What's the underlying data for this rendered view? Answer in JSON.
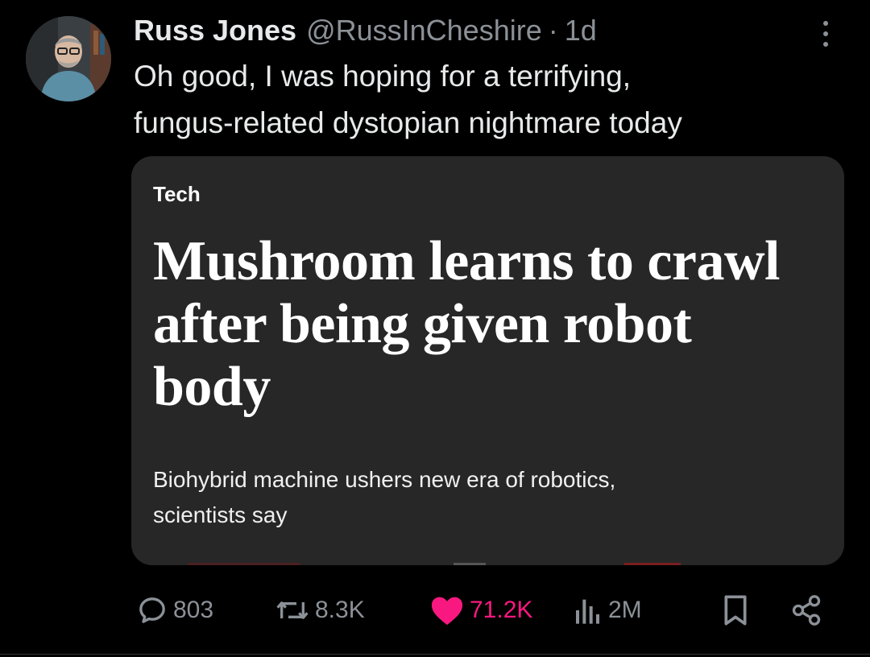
{
  "tweet": {
    "author_name": "Russ Jones",
    "author_handle": "@RussInCheshire",
    "separator": "·",
    "time": "1d",
    "text_line1": "Oh good, I was hoping for a terrifying,",
    "text_line2": "fungus-related dystopian nightmare today"
  },
  "card": {
    "category": "Tech",
    "headline_line1": "Mushroom learns to crawl",
    "headline_line2": "after being given robot",
    "headline_line3": "body",
    "subtitle_line1": "Biohybrid machine ushers new era of robotics,",
    "subtitle_line2": "scientists say"
  },
  "actions": {
    "replies": "803",
    "reposts": "8.3K",
    "likes": "71.2K",
    "views": "2M"
  },
  "icons": {
    "reply": "reply-icon",
    "repost": "repost-icon",
    "like": "heart-icon",
    "views": "views-icon",
    "bookmark": "bookmark-icon",
    "share": "share-icon",
    "more": "more-options-icon"
  },
  "colors": {
    "background": "#000000",
    "card_background": "#272727",
    "muted_text": "#8b9197",
    "like_accent": "#f91880"
  }
}
